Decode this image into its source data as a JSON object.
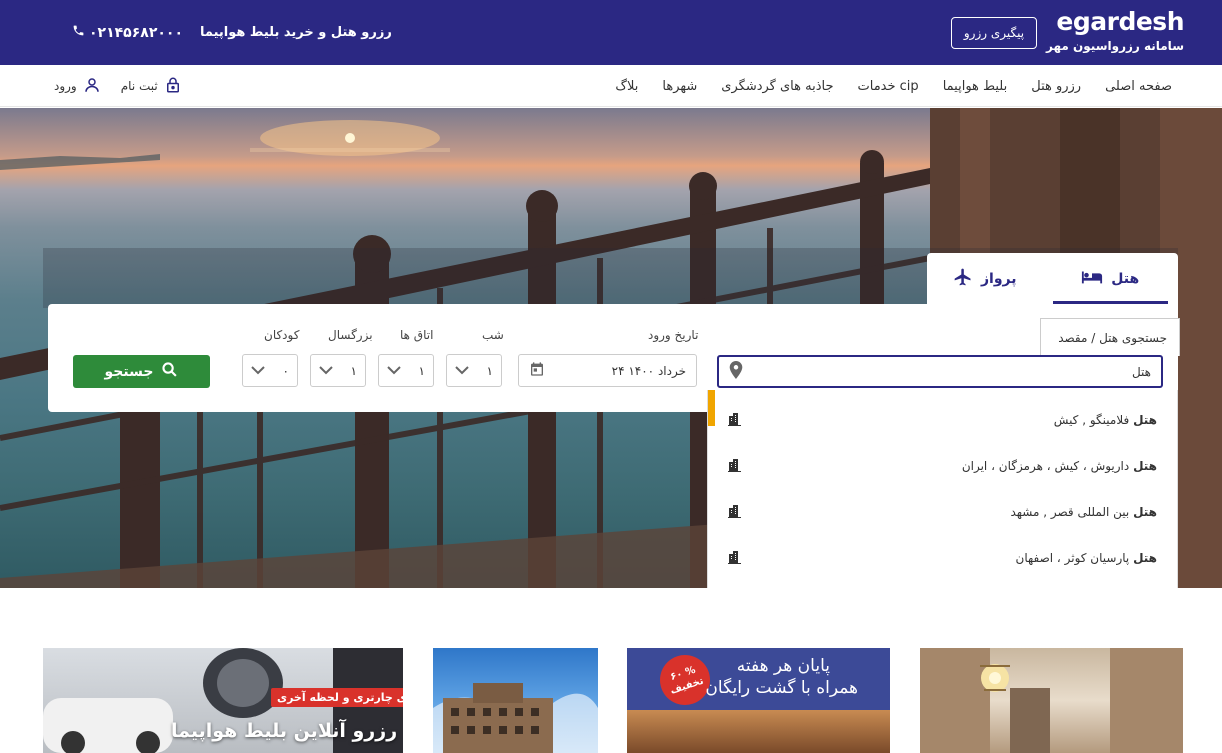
{
  "header": {
    "logo_text": "egardesh",
    "logo_subtitle": "سامانه رزرواسیون مهر",
    "track_button": "پیگیری رزرو",
    "slogan": "رزرو هتل و خرید بلیط هواپیما",
    "phone": "۰۲۱۴۵۶۸۲۰۰۰"
  },
  "nav": {
    "items": [
      "صفحه اصلی",
      "رزرو هتل",
      "بلیط هواپیما",
      "خدمات cip",
      "جاذبه های گردشگری",
      "شهرها",
      "بلاگ"
    ],
    "register": "ثبت نام",
    "login": "ورود"
  },
  "tabs": {
    "hotel": "هتل",
    "flight": "پرواز"
  },
  "search": {
    "destination_label": "جستجوی هتل / مقصد",
    "destination_value": "هتل",
    "checkin_label": "تاریخ ورود",
    "checkin_value": "۲۴ خرداد ۱۴۰۰",
    "nights_label": "شب",
    "nights_value": "۱",
    "rooms_label": "اتاق ها",
    "rooms_value": "۱",
    "adults_label": "بزرگسال",
    "adults_value": "۱",
    "children_label": "کودکان",
    "children_value": "۰",
    "button": "جستجو"
  },
  "suggestions": [
    {
      "prefix": "هتل",
      "rest": "فلامینگو , کیش"
    },
    {
      "prefix": "هتل",
      "rest": "داریوش ، کیش ، هرمزگان ، ایران"
    },
    {
      "prefix": "هتل",
      "rest": "بین المللی قصر , مشهد"
    },
    {
      "prefix": "هتل",
      "rest": "پارسیان کوثر ، اصفهان"
    }
  ],
  "promos": {
    "card1_tag": "نرخهای چارتری و لحظه آخری",
    "card1_title": "رزرو آنلاین بلیط هواپیما",
    "card3_line1": "پایان هر هفته",
    "card3_line2": "همراه با گشت رایگان",
    "card3_badge_pct": "۶۰ %",
    "card3_badge_text": "تخفیف"
  },
  "colors": {
    "brand": "#2b2883",
    "search_button": "#2e8b3a",
    "badge": "#d9322b",
    "scroll_indicator": "#f0a500"
  }
}
